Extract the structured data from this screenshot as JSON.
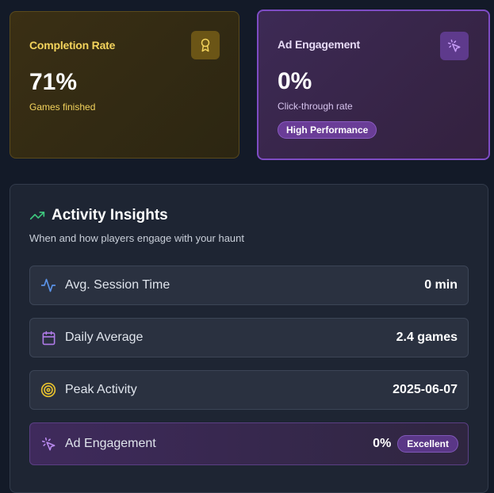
{
  "cards": {
    "completion": {
      "title": "Completion Rate",
      "value": "71%",
      "subtitle": "Games finished",
      "icon": "award-icon",
      "accent": "#f3d35c"
    },
    "ad": {
      "title": "Ad Engagement",
      "value": "0%",
      "subtitle": "Click-through rate",
      "badge": "High Performance",
      "icon": "cursor-click-icon",
      "accent": "#a874e8"
    }
  },
  "insights": {
    "title": "Activity Insights",
    "subtitle": "When and how players engage with your haunt",
    "icon": "trending-up-icon",
    "rows": [
      {
        "label": "Avg. Session Time",
        "value": "0 min",
        "icon": "activity-icon"
      },
      {
        "label": "Daily Average",
        "value": "2.4 games",
        "icon": "calendar-icon"
      },
      {
        "label": "Peak Activity",
        "value": "2025-06-07",
        "icon": "target-icon"
      },
      {
        "label": "Ad Engagement",
        "value": "0%",
        "badge": "Excellent",
        "icon": "cursor-click-icon"
      }
    ]
  }
}
